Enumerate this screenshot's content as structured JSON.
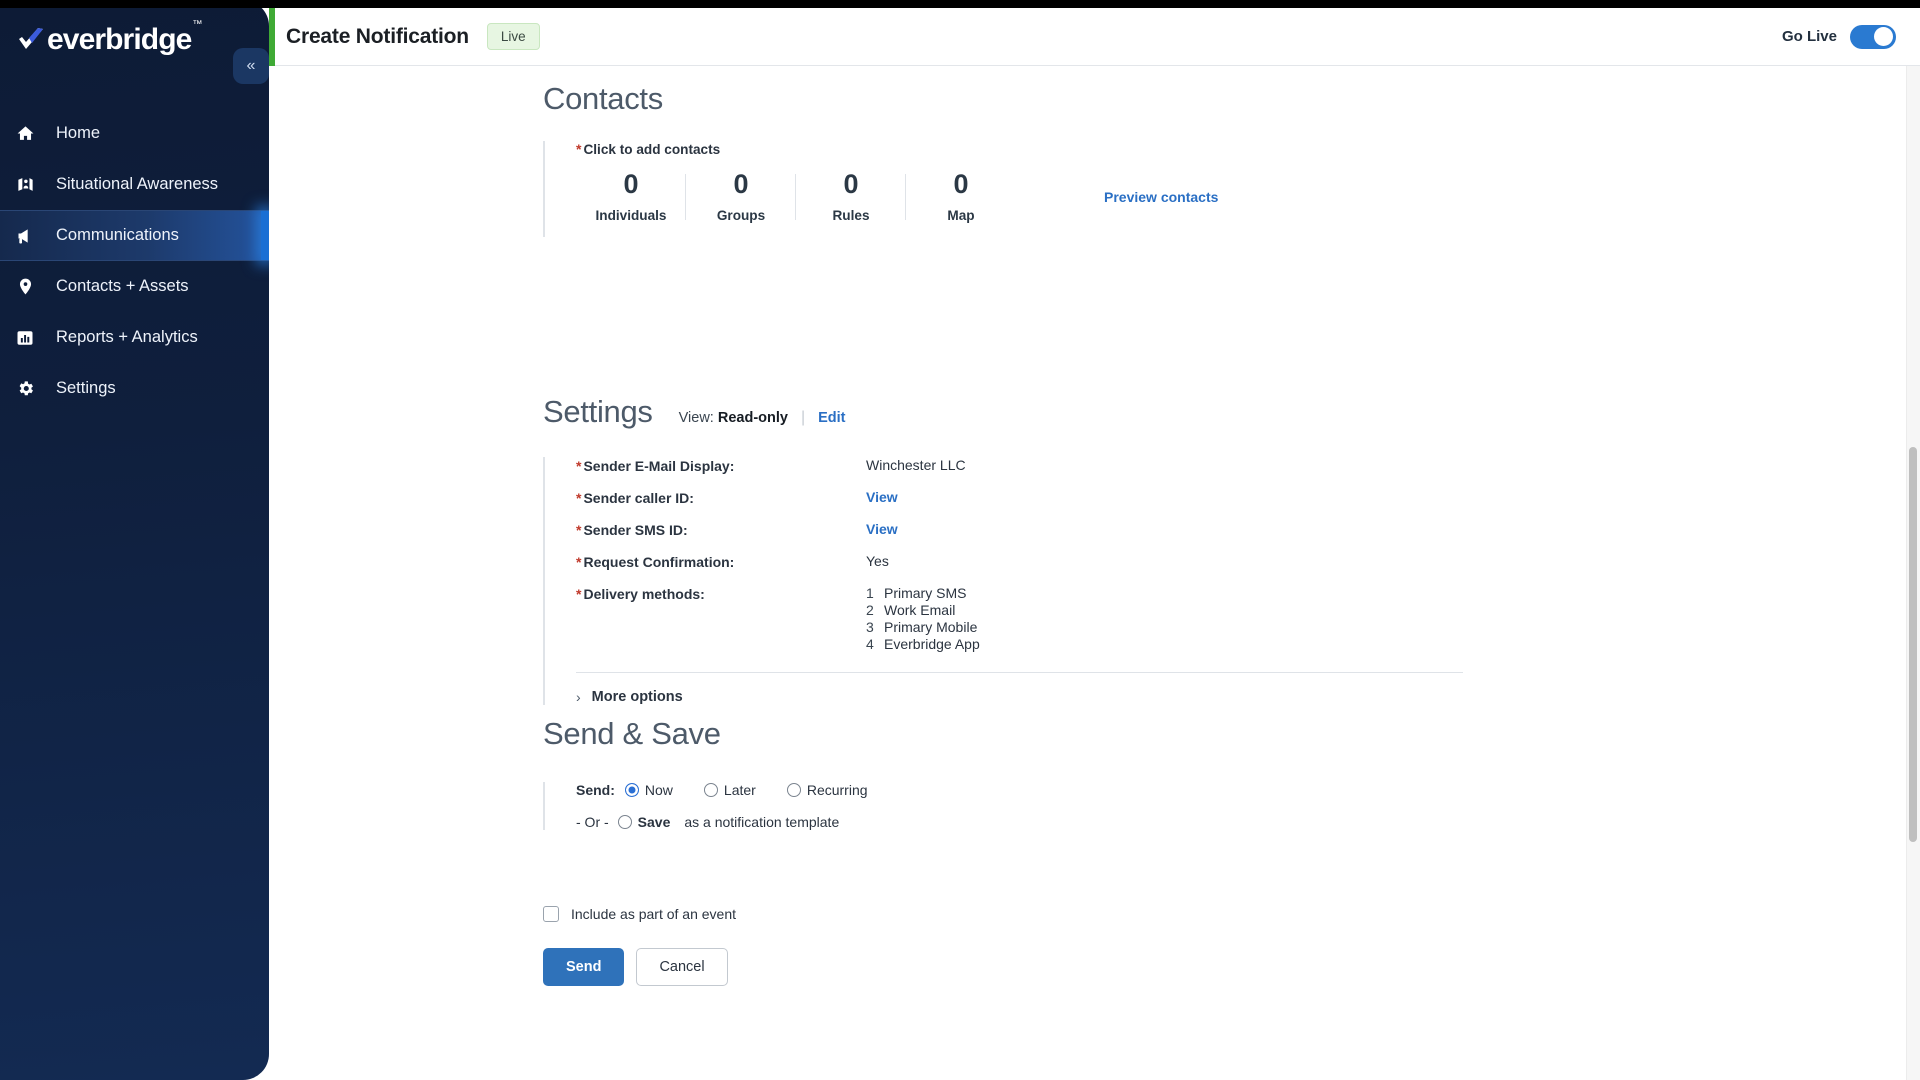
{
  "sidebar": {
    "brand": {
      "name": "everbridge",
      "tm": "™"
    },
    "collapse_icon": "«",
    "items": [
      {
        "label": "Home",
        "icon": "home-icon",
        "active": false
      },
      {
        "label": "Situational Awareness",
        "icon": "map-person-icon",
        "active": false
      },
      {
        "label": "Communications",
        "icon": "megaphone-icon",
        "active": true
      },
      {
        "label": "Contacts + Assets",
        "icon": "location-pin-icon",
        "active": false
      },
      {
        "label": "Reports + Analytics",
        "icon": "bar-chart-icon",
        "active": false
      },
      {
        "label": "Settings",
        "icon": "gear-icon",
        "active": false
      }
    ]
  },
  "header": {
    "title": "Create Notification",
    "badge": "Live",
    "go_live_label": "Go Live",
    "go_live_on": true
  },
  "contacts": {
    "title": "Contacts",
    "required_star": "*",
    "hint": "Click to add contacts",
    "counts": [
      {
        "value": "0",
        "label": "Individuals"
      },
      {
        "value": "0",
        "label": "Groups"
      },
      {
        "value": "0",
        "label": "Rules"
      },
      {
        "value": "0",
        "label": "Map"
      }
    ],
    "preview_link": "Preview contacts"
  },
  "settings": {
    "title": "Settings",
    "view_prefix": "View:",
    "view_mode": "Read-only",
    "separator": "|",
    "edit_link": "Edit",
    "rows": [
      {
        "label": "Sender E-Mail Display:",
        "value": "Winchester LLC",
        "is_link": false
      },
      {
        "label": "Sender caller ID:",
        "value": "View",
        "is_link": true
      },
      {
        "label": "Sender SMS ID:",
        "value": "View",
        "is_link": true
      },
      {
        "label": "Request Confirmation:",
        "value": "Yes",
        "is_link": false
      }
    ],
    "delivery_label": "Delivery methods:",
    "delivery_methods": [
      {
        "index": "1",
        "name": "Primary SMS"
      },
      {
        "index": "2",
        "name": "Work Email"
      },
      {
        "index": "3",
        "name": "Primary Mobile"
      },
      {
        "index": "4",
        "name": "Everbridge App"
      }
    ],
    "more_options": "More options",
    "more_options_icon": "chevron-right-icon"
  },
  "send_save": {
    "title": "Send & Save",
    "send_prefix": "Send:",
    "options": [
      {
        "label": "Now",
        "selected": true
      },
      {
        "label": "Later",
        "selected": false
      },
      {
        "label": "Recurring",
        "selected": false
      }
    ],
    "or_text": "- Or -",
    "save_label": "Save",
    "save_suffix": "as a notification template",
    "save_selected": false,
    "include_event_label": "Include as part of an event",
    "include_event_checked": false,
    "send_button": "Send",
    "cancel_button": "Cancel"
  },
  "colors": {
    "accent_green": "#3faa35",
    "link_blue": "#2a6fc4",
    "primary_blue": "#2f72ba",
    "sidebar_dark": "#0d1b36",
    "required_red": "#c0392b"
  }
}
